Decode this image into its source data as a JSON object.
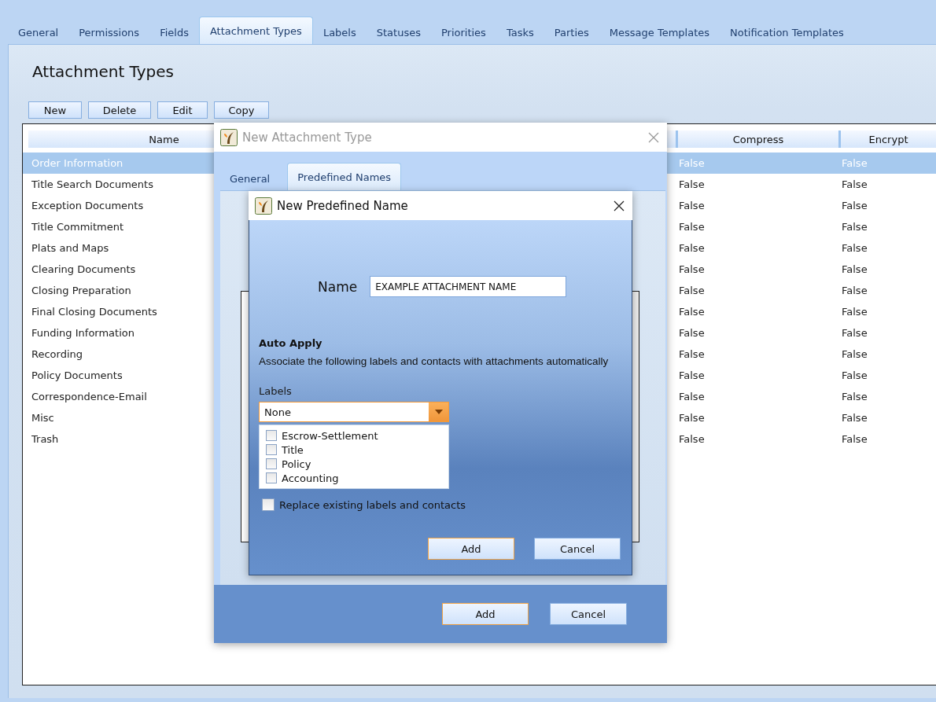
{
  "tabs": [
    {
      "label": "General",
      "selected": false
    },
    {
      "label": "Permissions",
      "selected": false
    },
    {
      "label": "Fields",
      "selected": false
    },
    {
      "label": "Attachment Types",
      "selected": true
    },
    {
      "label": "Labels",
      "selected": false
    },
    {
      "label": "Statuses",
      "selected": false
    },
    {
      "label": "Priorities",
      "selected": false
    },
    {
      "label": "Tasks",
      "selected": false
    },
    {
      "label": "Parties",
      "selected": false
    },
    {
      "label": "Message Templates",
      "selected": false
    },
    {
      "label": "Notification Templates",
      "selected": false
    }
  ],
  "page_title": "Attachment Types",
  "toolbar": [
    "New",
    "Delete",
    "Edit",
    "Copy"
  ],
  "table": {
    "columns": [
      "Name",
      "",
      "Compress",
      "Encrypt"
    ],
    "rows": [
      {
        "name": "Order Information",
        "compress": "False",
        "encrypt": "False",
        "selected": true
      },
      {
        "name": "Title Search Documents",
        "compress": "False",
        "encrypt": "False",
        "selected": false
      },
      {
        "name": "Exception Documents",
        "compress": "False",
        "encrypt": "False",
        "selected": false
      },
      {
        "name": "Title Commitment",
        "compress": "False",
        "encrypt": "False",
        "selected": false
      },
      {
        "name": "Plats and Maps",
        "compress": "False",
        "encrypt": "False",
        "selected": false
      },
      {
        "name": "Clearing Documents",
        "compress": "False",
        "encrypt": "False",
        "selected": false
      },
      {
        "name": "Closing Preparation",
        "compress": "False",
        "encrypt": "False",
        "selected": false
      },
      {
        "name": "Final Closing Documents",
        "compress": "False",
        "encrypt": "False",
        "selected": false
      },
      {
        "name": "Funding Information",
        "compress": "False",
        "encrypt": "False",
        "selected": false
      },
      {
        "name": "Recording",
        "compress": "False",
        "encrypt": "False",
        "selected": false
      },
      {
        "name": "Policy Documents",
        "compress": "False",
        "encrypt": "False",
        "selected": false
      },
      {
        "name": "Correspondence-Email",
        "compress": "False",
        "encrypt": "False",
        "selected": false
      },
      {
        "name": "Misc",
        "compress": "False",
        "encrypt": "False",
        "selected": false
      },
      {
        "name": "Trash",
        "compress": "False",
        "encrypt": "False",
        "selected": false
      }
    ]
  },
  "outer_dialog": {
    "title": "New Attachment Type",
    "tabs": [
      {
        "label": "General",
        "selected": false
      },
      {
        "label": "Predefined Names",
        "selected": true
      }
    ],
    "buttons": [
      {
        "label": "Add",
        "default": true
      },
      {
        "label": "Cancel",
        "default": false
      }
    ]
  },
  "inner_dialog": {
    "title": "New Predefined Name",
    "name_label": "Name",
    "name_value": "EXAMPLE ATTACHMENT NAME",
    "section_title": "Auto Apply",
    "description": "Associate the following labels and contacts with attachments automatically",
    "labels_label": "Labels",
    "labels_value": "None",
    "label_options": [
      {
        "label": "Escrow-Settlement",
        "checked": false
      },
      {
        "label": "Title",
        "checked": false
      },
      {
        "label": "Policy",
        "checked": false
      },
      {
        "label": "Accounting",
        "checked": false
      }
    ],
    "replace": {
      "label": "Replace existing labels and contacts",
      "checked": false
    },
    "buttons": [
      {
        "label": "Add",
        "default": true
      },
      {
        "label": "Cancel",
        "default": false
      }
    ]
  }
}
